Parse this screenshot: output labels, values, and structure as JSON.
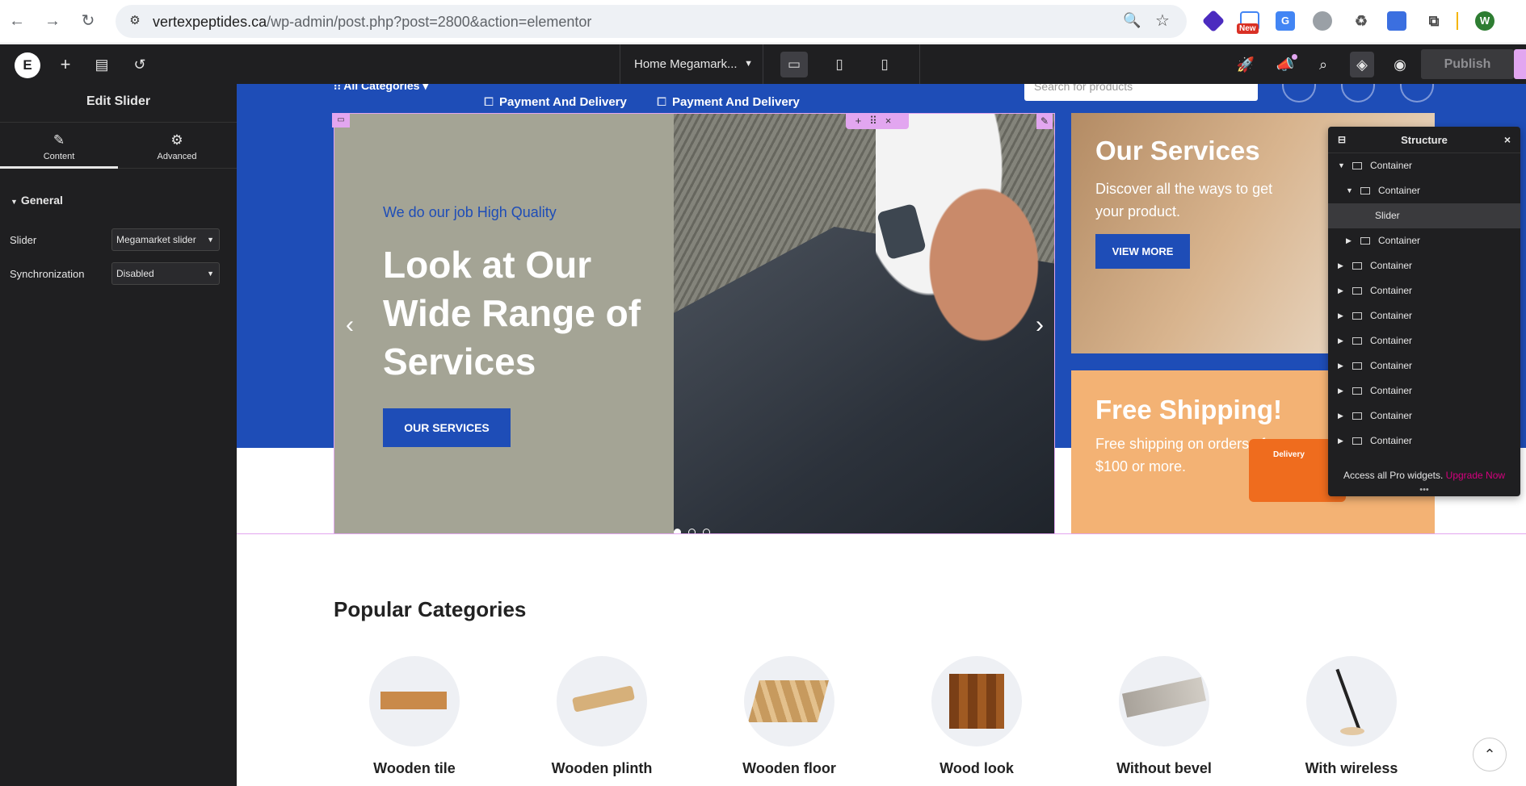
{
  "browser": {
    "url_host": "vertexpeptides.ca",
    "url_path": "/wp-admin/post.php?post=2800&action=elementor",
    "ext_new_badge": "New",
    "profile_initial": "W"
  },
  "topbar": {
    "logo": "E",
    "document": "Home Megamark...",
    "publish": "Publish"
  },
  "panel": {
    "title": "Edit Slider",
    "tabs": [
      {
        "label": "Content"
      },
      {
        "label": "Advanced"
      }
    ],
    "section": "General",
    "controls": [
      {
        "label": "Slider",
        "value": "Megamarket slider"
      },
      {
        "label": "Synchronization",
        "value": "Disabled"
      }
    ]
  },
  "site": {
    "all_categories": "All Categories",
    "menu": [
      "Payment And Delivery",
      "Payment And Delivery"
    ],
    "search_placeholder": "Search for products",
    "slide": {
      "sub_prefix": "We do our job ",
      "sub_highlight": "High Quality",
      "title": "Look at Our Wide Range of Services",
      "button": "OUR SERVICES"
    },
    "card1": {
      "title": "Our Services",
      "text": "Discover all the ways to get your product.",
      "button": "VIEW MORE"
    },
    "card2": {
      "title": "Free Shipping!",
      "text": "Free shipping on orders of $100 or more.",
      "truck_label": "Delivery"
    },
    "popular_title": "Popular Categories",
    "categories": [
      {
        "name": "Wooden tile"
      },
      {
        "name": "Wooden plinth"
      },
      {
        "name": "Wooden floor"
      },
      {
        "name": "Wood look"
      },
      {
        "name": "Without bevel"
      },
      {
        "name": "With wireless"
      }
    ]
  },
  "structure": {
    "title": "Structure",
    "items": [
      {
        "label": "Container",
        "expanded": true
      },
      {
        "label": "Container",
        "expanded": true
      },
      {
        "label": "Slider",
        "selected": true
      },
      {
        "label": "Container"
      },
      {
        "label": "Container"
      },
      {
        "label": "Container"
      },
      {
        "label": "Container"
      },
      {
        "label": "Container"
      },
      {
        "label": "Container"
      },
      {
        "label": "Container"
      },
      {
        "label": "Container"
      },
      {
        "label": "Container"
      }
    ],
    "footer_text": "Access all Pro widgets.",
    "footer_link": "Upgrade Now"
  },
  "colors": {
    "brand_blue": "#1e4db7",
    "editor_dark": "#1f1f21",
    "handle_pink": "#e2a6f0",
    "upgrade_link": "#d5007f"
  }
}
